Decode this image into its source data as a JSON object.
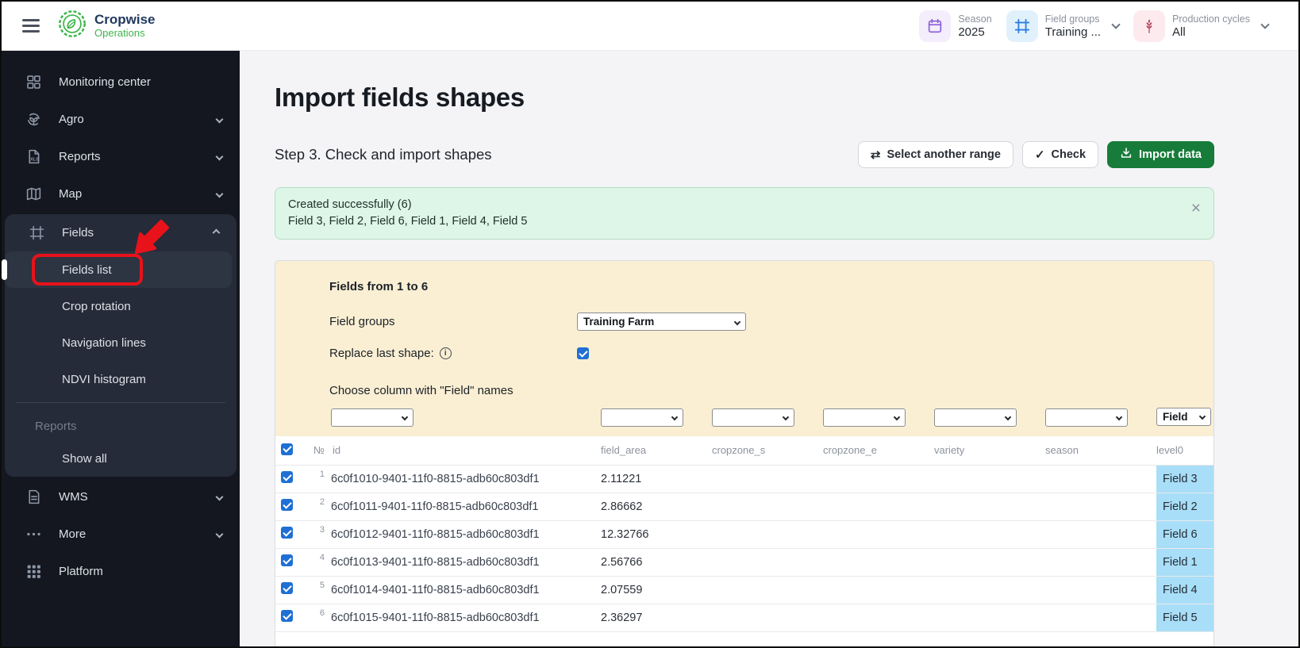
{
  "colors": {
    "brand_green": "#3db54a",
    "import_button_green": "#177c3a",
    "annotation_red": "#e8121a",
    "level0_cell_blue": "#a9def8",
    "form_panel_yellow": "#faefd3",
    "alert_green_bg": "#ddf6e8",
    "checkbox_blue": "#1f6fd4"
  },
  "header": {
    "brand_name": "Cropwise",
    "brand_sub": "Operations",
    "selectors": [
      {
        "icon": "calendar-icon",
        "label": "Season",
        "value": "2025",
        "chevron": false
      },
      {
        "icon": "field-groups-icon",
        "label": "Field groups",
        "value": "Training ...",
        "chevron": true
      },
      {
        "icon": "wheat-icon",
        "label": "Production cycles",
        "value": "All",
        "chevron": true
      }
    ]
  },
  "sidebar": {
    "items": [
      {
        "id": "monitoring-center",
        "label": "Monitoring center",
        "icon": "dashboard-icon"
      },
      {
        "id": "agro",
        "label": "Agro",
        "icon": "agro-icon",
        "chevron": "down"
      },
      {
        "id": "reports",
        "label": "Reports",
        "icon": "xls-icon",
        "chevron": "down"
      },
      {
        "id": "map",
        "label": "Map",
        "icon": "map-icon",
        "chevron": "down"
      },
      {
        "id": "fields",
        "label": "Fields",
        "icon": "fields-icon",
        "chevron": "up",
        "group": "start"
      },
      {
        "id": "fields-list",
        "label": "Fields list",
        "sub": true,
        "active": true
      },
      {
        "id": "crop-rotation",
        "label": "Crop rotation",
        "sub": true
      },
      {
        "id": "navigation-lines",
        "label": "Navigation lines",
        "sub": true
      },
      {
        "id": "ndvi-histogram",
        "label": "NDVI histogram",
        "sub": true
      },
      {
        "divider": true
      },
      {
        "section": "Reports"
      },
      {
        "id": "show-all",
        "label": "Show all",
        "sub": true,
        "group": "end"
      },
      {
        "id": "wms",
        "label": "WMS",
        "icon": "doc-icon",
        "chevron": "down"
      },
      {
        "id": "more",
        "label": "More",
        "icon": "more-icon",
        "chevron": "down"
      },
      {
        "id": "platform",
        "label": "Platform",
        "icon": "grid-icon"
      }
    ]
  },
  "main": {
    "title": "Import fields shapes",
    "step_title": "Step 3. Check and import shapes",
    "buttons": {
      "select_range": "Select another range",
      "check": "Check",
      "import": "Import data"
    },
    "alert": {
      "title": "Created successfully (6)",
      "details": "Field 3, Field 2, Field 6, Field 1, Field 4, Field 5",
      "close": "×"
    },
    "form": {
      "range_title": "Fields from 1 to 6",
      "field_groups_label": "Field groups",
      "field_groups_value": "Training Farm",
      "replace_label": "Replace last shape:",
      "replace_checked": true,
      "choose_label": "Choose column with \"Field\" names",
      "column_selects": [
        "",
        "",
        "",
        "",
        "",
        "",
        "Field"
      ]
    },
    "table": {
      "headers": [
        "№",
        "id",
        "field_area",
        "cropzone_s",
        "cropzone_e",
        "variety",
        "season",
        "level0"
      ],
      "rows": [
        {
          "num": "1",
          "id": "6c0f1010-9401-11f0-8815-adb60c803df1",
          "field_area": "2.11221",
          "cropzone_s": "",
          "cropzone_e": "",
          "variety": "",
          "season": "",
          "level0": "Field 3"
        },
        {
          "num": "2",
          "id": "6c0f1011-9401-11f0-8815-adb60c803df1",
          "field_area": "2.86662",
          "cropzone_s": "",
          "cropzone_e": "",
          "variety": "",
          "season": "",
          "level0": "Field 2"
        },
        {
          "num": "3",
          "id": "6c0f1012-9401-11f0-8815-adb60c803df1",
          "field_area": "12.32766",
          "cropzone_s": "",
          "cropzone_e": "",
          "variety": "",
          "season": "",
          "level0": "Field 6"
        },
        {
          "num": "4",
          "id": "6c0f1013-9401-11f0-8815-adb60c803df1",
          "field_area": "2.56766",
          "cropzone_s": "",
          "cropzone_e": "",
          "variety": "",
          "season": "",
          "level0": "Field 1"
        },
        {
          "num": "5",
          "id": "6c0f1014-9401-11f0-8815-adb60c803df1",
          "field_area": "2.07559",
          "cropzone_s": "",
          "cropzone_e": "",
          "variety": "",
          "season": "",
          "level0": "Field 4"
        },
        {
          "num": "6",
          "id": "6c0f1015-9401-11f0-8815-adb60c803df1",
          "field_area": "2.36297",
          "cropzone_s": "",
          "cropzone_e": "",
          "variety": "",
          "season": "",
          "level0": "Field 5"
        }
      ]
    }
  }
}
